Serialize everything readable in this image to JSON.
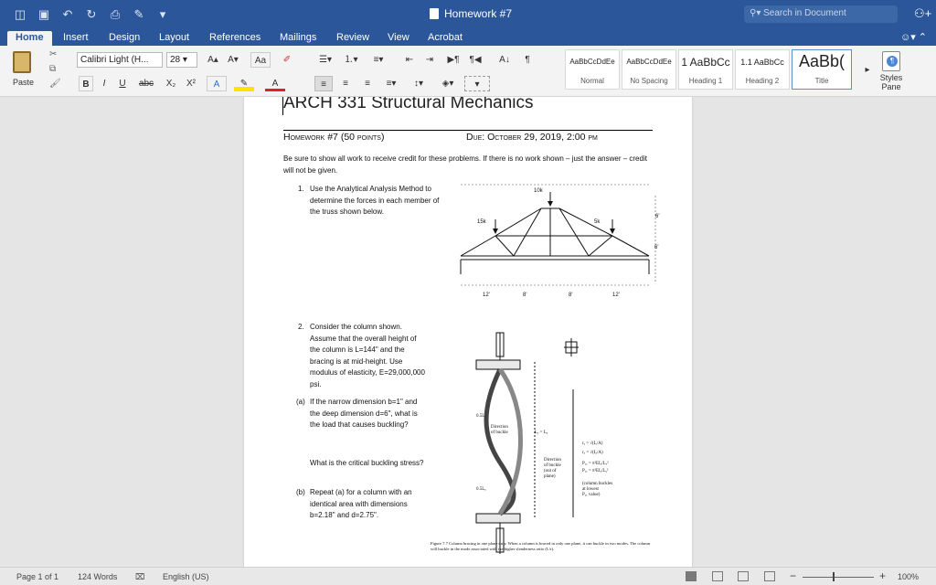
{
  "title_bar": {
    "doc_title": "Homework #7",
    "search_placeholder": "Search in Document"
  },
  "tabs": [
    "Home",
    "Insert",
    "Design",
    "Layout",
    "References",
    "Mailings",
    "Review",
    "View",
    "Acrobat"
  ],
  "ribbon": {
    "paste_label": "Paste",
    "font_name": "Calibri Light (H...",
    "font_size": "28",
    "styles": [
      {
        "preview": "AaBbCcDdEe",
        "label": "Normal"
      },
      {
        "preview": "AaBbCcDdEe",
        "label": "No Spacing"
      },
      {
        "preview": "1 AaBbCc",
        "label": "Heading 1"
      },
      {
        "preview": "1.1 AaBbCc",
        "label": "Heading 2"
      },
      {
        "preview": "AaBb(",
        "label": "Title"
      }
    ],
    "styles_pane_label": "Styles Pane"
  },
  "document": {
    "heading": "ARCH 331 Structural Mechanics",
    "hw_label": "Homework #7 (50 points)",
    "due_label": "Due: October 29, 2019, 2:00 pm",
    "intro": "Be sure to show all work to receive credit for these problems. If there is no work shown – just the answer – credit will not be given.",
    "q1_num": "1.",
    "q1_text": "Use the Analytical Analysis Method to determine the forces in each member of the truss shown below.",
    "q2_num": "2.",
    "q2_text": "Consider the column shown. Assume that the overall height of the column is L=144\" and the bracing is at mid-height. Use modulus of elasticity, E=29,000,000 psi.",
    "qa_label": "(a)",
    "qa_text": "If the narrow dimension b=1\" and the deep dimension d=6\", what is the load that causes buckling?",
    "qa_text2": "What is the critical buckling stress?",
    "qb_label": "(b)",
    "qb_text": "Repeat (a) for a column with an identical area with dimensions b=2.18\" and d=2.75\".",
    "fig_caption": "Figure 7.7  Column bracing in one plane only. When a column is braced in only one plane, it can buckle in two modes. The column will buckle in the mode associated with the higher slenderness ratio (L/r).",
    "truss_labels": [
      "10k",
      "15k",
      "5k",
      "6'",
      "6'",
      "12'",
      "8'",
      "8'",
      "12'"
    ]
  },
  "status_bar": {
    "page": "Page 1 of 1",
    "words": "124 Words",
    "language": "English (US)",
    "zoom": "100%"
  }
}
